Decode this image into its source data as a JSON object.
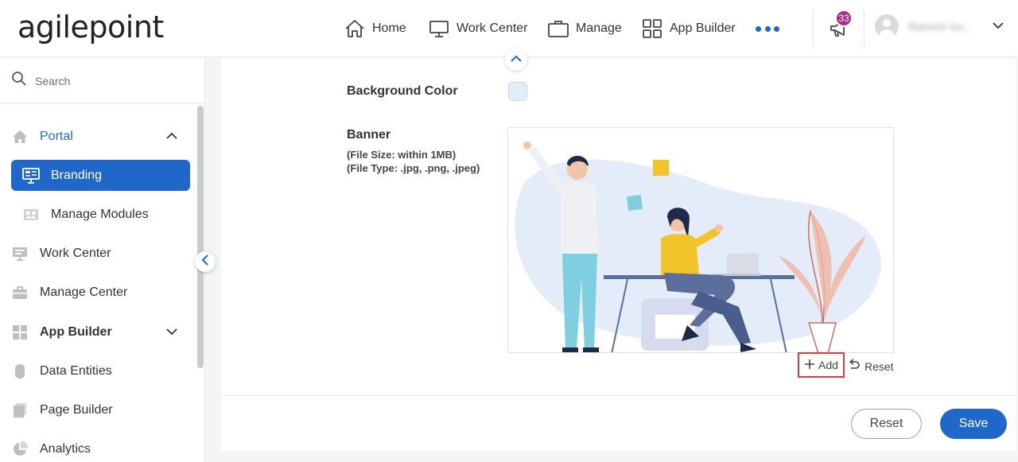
{
  "brand": {
    "logo_text": "agilepoint",
    "accent": "#1f67c8"
  },
  "header": {
    "nav": [
      {
        "label": "Home",
        "icon": "home-icon"
      },
      {
        "label": "Work Center",
        "icon": "monitor-icon"
      },
      {
        "label": "Manage",
        "icon": "briefcase-icon"
      },
      {
        "label": "App Builder",
        "icon": "grid-icon"
      }
    ],
    "more_icon": "more-dots-icon",
    "notifications": {
      "count": "33",
      "icon": "megaphone-icon",
      "badge_color": "#b0278f"
    },
    "user": {
      "name": "Ramesh Go..."
    }
  },
  "sidebar": {
    "search": {
      "placeholder": "Search"
    },
    "items": [
      {
        "label": "Portal",
        "icon": "home-icon",
        "expanded": true
      },
      {
        "label": "Branding",
        "icon": "branding-icon",
        "active": true
      },
      {
        "label": "Manage Modules",
        "icon": "modules-icon"
      },
      {
        "label": "Work Center",
        "icon": "monitor-icon"
      },
      {
        "label": "Manage Center",
        "icon": "briefcase-icon"
      },
      {
        "label": "App Builder",
        "icon": "grid-icon",
        "expanded": false
      },
      {
        "label": "Data Entities",
        "icon": "database-icon"
      },
      {
        "label": "Page Builder",
        "icon": "page-icon"
      },
      {
        "label": "Analytics",
        "icon": "pie-icon"
      }
    ]
  },
  "main": {
    "background_color": {
      "label": "Background Color",
      "value": "#e3edfa"
    },
    "banner": {
      "label": "Banner",
      "hint_size": "(File Size: within 1MB)",
      "hint_type": "(File Type: .jpg, .png, .jpeg)",
      "add_label": "Add",
      "reset_label": "Reset"
    },
    "footer": {
      "reset_label": "Reset",
      "save_label": "Save"
    }
  }
}
